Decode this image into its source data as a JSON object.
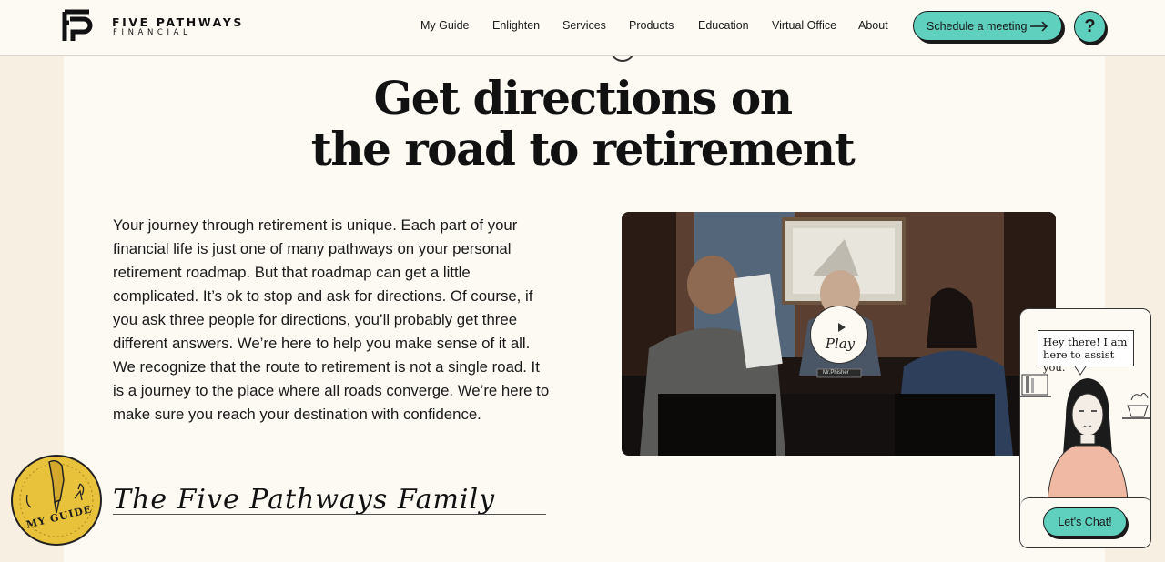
{
  "brand": {
    "name_line1": "FIVE PATHWAYS",
    "name_line2": "FINANCIAL"
  },
  "nav": {
    "items": [
      {
        "label": "My Guide"
      },
      {
        "label": "Enlighten"
      },
      {
        "label": "Services"
      },
      {
        "label": "Products"
      },
      {
        "label": "Education"
      },
      {
        "label": "Virtual Office"
      },
      {
        "label": "About"
      }
    ],
    "cta_label": "Schedule a meeting",
    "help_label": "?"
  },
  "hero": {
    "headline_line1": "Get directions on",
    "headline_line2": "the road to retirement",
    "body": "Your journey through retirement is unique. Each part of your financial life is just one of many pathways on your personal retirement roadmap. But that roadmap can get a little complicated. It’s ok to stop and ask for directions. Of course, if you ask three people for directions, you’ll probably get three different answers. We’re here to help you make sense of it all. We recognize that the route to retirement is not a single road. It is a journey to the place where all roads converge. We’re here to make sure you reach your destination with confidence.",
    "signature": "The Five Pathways Family"
  },
  "video": {
    "play_label": "Play",
    "nameplate": "Mr.Phisher"
  },
  "guide_badge": {
    "label": "MY GUIDE"
  },
  "chat": {
    "bubble_line1": "Hey there! I am",
    "bubble_line2": "here to assist you.",
    "button_label": "Let's Chat!"
  },
  "colors": {
    "accent": "#5fcfbe",
    "page_bg": "#f6efe2",
    "panel_bg": "#fdfaf4",
    "badge_gold": "#e9c23c"
  }
}
